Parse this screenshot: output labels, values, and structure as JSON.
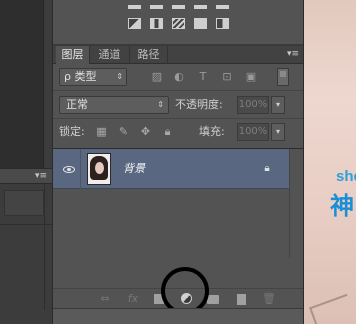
{
  "adjustments": {
    "row2_icons": [
      "levels-adjust-icon",
      "curves-adjust-icon",
      "gradient-map-icon",
      "threshold-icon",
      "selective-color-icon"
    ]
  },
  "tabs": [
    {
      "label": "图层",
      "active": true
    },
    {
      "label": "通道",
      "active": false
    },
    {
      "label": "路径",
      "active": false
    }
  ],
  "tab_menu_glyph": "▾≡",
  "filter": {
    "kind_label": "ρ 类型",
    "kind_arrow": "⇕"
  },
  "blend": {
    "mode": "正常",
    "arrow": "⇕",
    "opacity_label": "不透明度:",
    "opacity_value": "100%",
    "drop_glyph": "▾"
  },
  "lock": {
    "label": "锁定:",
    "fill_label": "填充:",
    "fill_value": "100%",
    "drop_glyph": "▾"
  },
  "layers": [
    {
      "name": "背景",
      "visible": true,
      "locked": true
    }
  ],
  "bottom_bar": {
    "link_glyph": "⇔",
    "fx_glyph": "fx"
  },
  "canvas_text": {
    "line1": "she",
    "line2": "神"
  },
  "left_panel_menu_glyph": "▾≡",
  "colors": {
    "panel_bg": "#535353",
    "selected_layer": "#596880",
    "annotation": "#000000"
  }
}
